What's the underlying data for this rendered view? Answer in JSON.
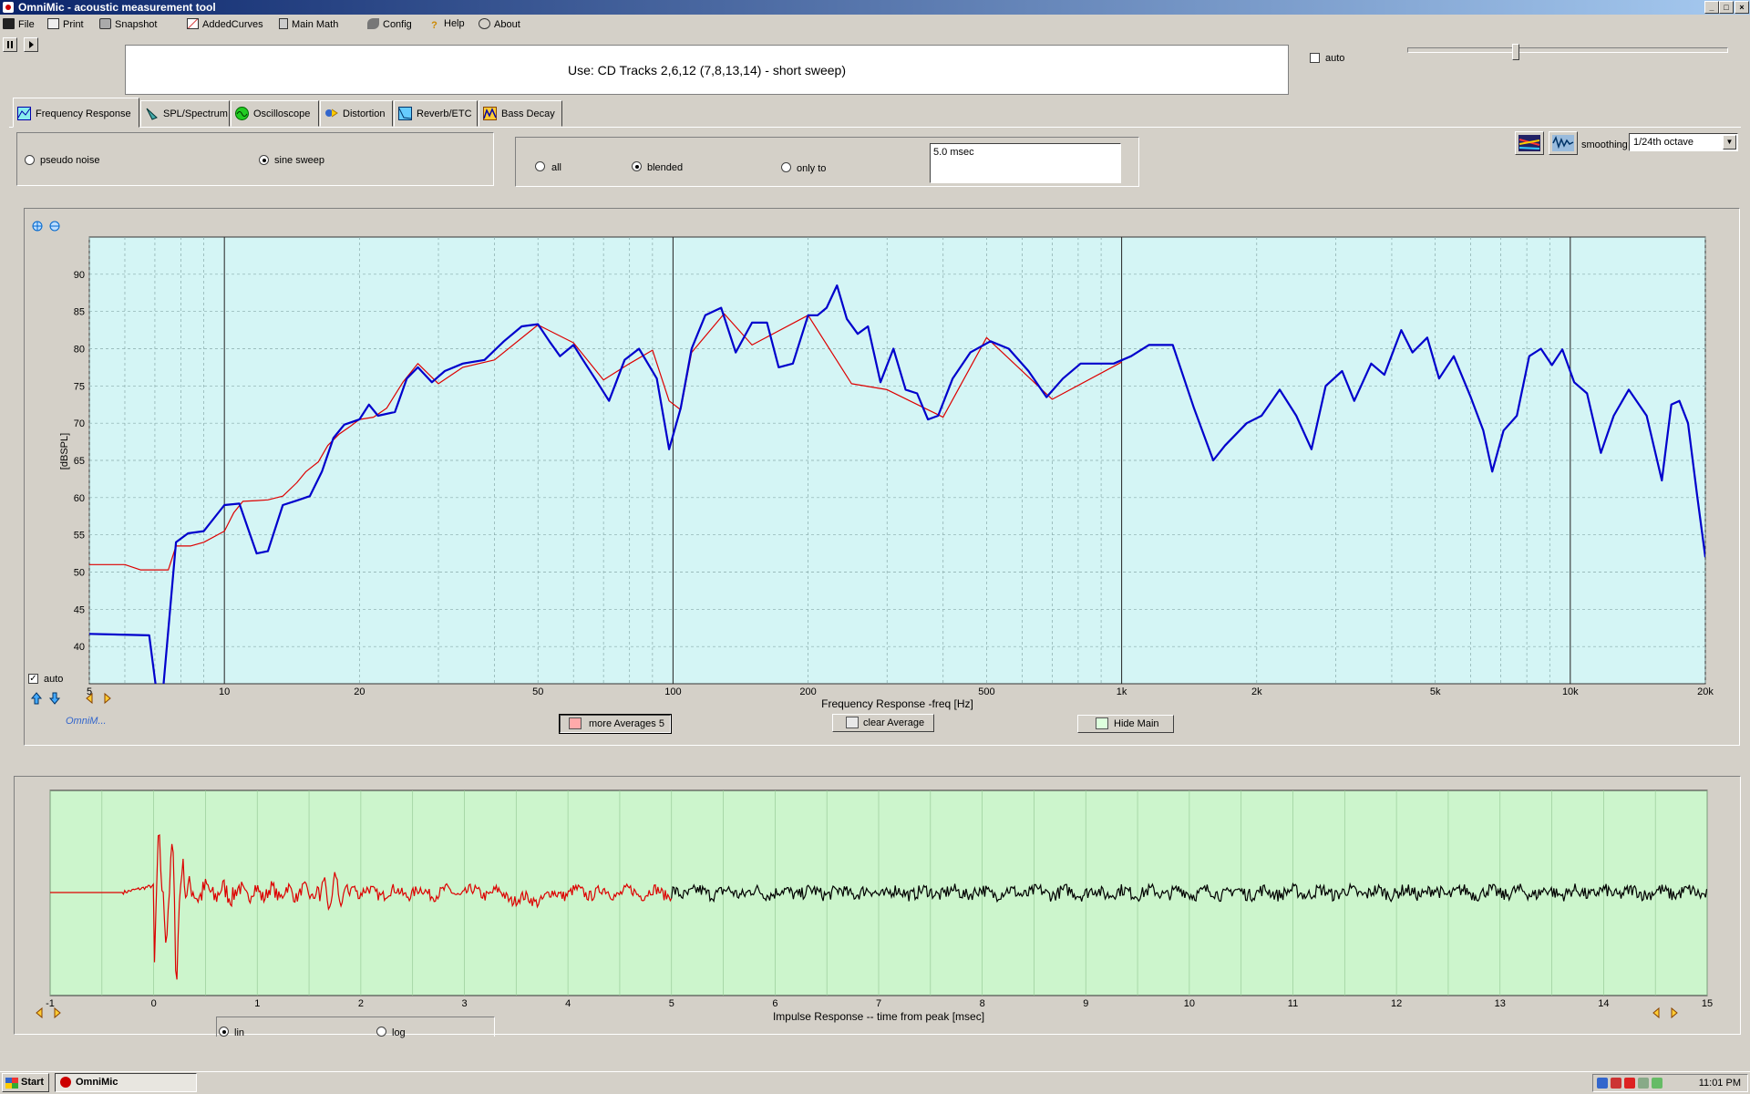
{
  "window": {
    "title": "OmniMic - acoustic measurement tool",
    "min": "_",
    "max": "□",
    "close": "×"
  },
  "menu": [
    {
      "label": "File"
    },
    {
      "label": "Print"
    },
    {
      "label": "Snapshot"
    },
    {
      "label": "AddedCurves"
    },
    {
      "label": "Main Math"
    },
    {
      "label": "Config"
    },
    {
      "label": "Help"
    },
    {
      "label": "About"
    }
  ],
  "instruction": "Use: CD Tracks 2,6,12 (7,8,13,14) - short sweep)",
  "top_auto_label": "auto",
  "tabs": [
    {
      "label": "Frequency Response",
      "active": true
    },
    {
      "label": "SPL/Spectrum"
    },
    {
      "label": "Oscilloscope"
    },
    {
      "label": "Distortion"
    },
    {
      "label": "Reverb/ETC"
    },
    {
      "label": "Bass Decay"
    }
  ],
  "signal": {
    "options": [
      {
        "label": "pseudo noise",
        "selected": false
      },
      {
        "label": "sine sweep",
        "selected": true
      }
    ]
  },
  "gating": {
    "options": [
      {
        "label": "all",
        "selected": false
      },
      {
        "label": "blended",
        "selected": true
      },
      {
        "label": "only to",
        "selected": false
      }
    ],
    "window_value": "5.0 msec"
  },
  "smoothing": {
    "label": "smoothing",
    "value": "1/24th octave"
  },
  "freq_panel": {
    "auto_label": "auto",
    "auto_checked": true,
    "logo_text": "OmniM...",
    "buttons": {
      "more_averages": "more Averages 5",
      "clear_average": "clear Average",
      "hide_main": "Hide Main"
    }
  },
  "impulse_panel": {
    "scale_options": [
      {
        "label": "lin",
        "selected": true
      },
      {
        "label": "log",
        "selected": false
      }
    ]
  },
  "chart_data": [
    {
      "type": "line",
      "title": "",
      "xlabel": "Frequency Response -freq [Hz]",
      "ylabel": "[dBSPL]",
      "x_scale": "log",
      "xlim": [
        5,
        20000
      ],
      "ylim": [
        35,
        95
      ],
      "x_ticks": [
        5,
        10,
        20,
        50,
        100,
        200,
        500,
        1000,
        2000,
        5000,
        10000,
        20000
      ],
      "x_tick_labels": [
        "5",
        "10",
        "20",
        "50",
        "100",
        "200",
        "500",
        "1k",
        "2k",
        "5k",
        "10k",
        "20k"
      ],
      "y_ticks": [
        40,
        45,
        50,
        55,
        60,
        65,
        70,
        75,
        80,
        85,
        90
      ],
      "grid": true,
      "series": [
        {
          "color": "#0000cc",
          "x": [
            5,
            6.8,
            7.2,
            7.8,
            8.3,
            9,
            10,
            10.8,
            11.8,
            12.5,
            13.5,
            14.5,
            15.5,
            16.5,
            17.5,
            18.5,
            20,
            21,
            22,
            24,
            25.5,
            27,
            29,
            31,
            34,
            38,
            42,
            46,
            50,
            53,
            56,
            60,
            63,
            67,
            72,
            78,
            84,
            92,
            98,
            104,
            110,
            118,
            128,
            138,
            150,
            162,
            172,
            185,
            200,
            210,
            220,
            232,
            244,
            258,
            272,
            290,
            310,
            330,
            350,
            370,
            390,
            420,
            460,
            510,
            560,
            620,
            680,
            740,
            810,
            880,
            960,
            1050,
            1150,
            1300,
            1450,
            1600,
            1700,
            1900,
            2050,
            2250,
            2450,
            2650,
            2850,
            3100,
            3300,
            3600,
            3850,
            4200,
            4450,
            4800,
            5100,
            5500,
            6000,
            6400,
            6700,
            7100,
            7600,
            8100,
            8600,
            9100,
            9600,
            10200,
            10900,
            11700,
            12500,
            13500,
            14800,
            16000,
            16800,
            17500,
            18300,
            19200,
            20000
          ],
          "y": [
            41.7,
            41.5,
            30,
            54,
            55.2,
            55.5,
            59,
            59.2,
            52.5,
            52.8,
            59,
            59.6,
            60.2,
            63.5,
            68,
            69.8,
            70.5,
            72.5,
            71,
            71.5,
            76,
            77.5,
            75.5,
            77,
            78,
            78.5,
            81,
            83,
            83.3,
            81,
            79,
            80.5,
            78.5,
            76,
            73,
            78.5,
            80,
            76,
            66.5,
            72,
            80,
            84.5,
            85.5,
            79.5,
            83.5,
            83.5,
            77.5,
            78,
            84.5,
            84.5,
            85.5,
            88.5,
            84,
            82,
            83,
            75.5,
            80,
            74.5,
            74,
            70.5,
            71,
            76,
            79.5,
            81,
            80,
            77,
            73.5,
            76,
            78,
            78,
            78,
            79,
            80.5,
            80.5,
            72,
            65,
            67,
            70,
            71,
            74.5,
            71,
            66.5,
            75,
            77,
            73,
            78,
            76.5,
            82.5,
            79.5,
            81.5,
            76,
            79,
            73.5,
            69,
            63.5,
            69,
            71,
            79,
            80,
            77.8,
            79.9,
            75.5,
            74,
            66,
            71,
            74.5,
            71,
            62.3,
            72.5,
            73,
            70,
            60,
            52
          ]
        },
        {
          "color": "#dd0000",
          "x": [
            5,
            5.5,
            6,
            6.5,
            7.2,
            7.5,
            7.8,
            8.4,
            9,
            10,
            10.5,
            11,
            11.8,
            12.5,
            13.5,
            14.5,
            15.2,
            16.2,
            17,
            18,
            19,
            20,
            21.5,
            23,
            25,
            27,
            30,
            34,
            40,
            50,
            60,
            70,
            80,
            90,
            98,
            104,
            110,
            130,
            150,
            200,
            250,
            300,
            400,
            500,
            700,
            1000
          ],
          "y": [
            51,
            51,
            51,
            50.3,
            50.3,
            50.3,
            53.5,
            53.5,
            54,
            55.5,
            58,
            59.5,
            59.6,
            59.7,
            60.2,
            62,
            63.5,
            64.8,
            67,
            68.5,
            69.5,
            70.5,
            70.8,
            72,
            75.5,
            78,
            75.3,
            77.5,
            78.5,
            83.2,
            80.8,
            75.8,
            78,
            79.8,
            73,
            71.8,
            79.5,
            84.7,
            80.5,
            84.5,
            75.3,
            74.5,
            70.8,
            81.5,
            73.2,
            78.2
          ]
        }
      ]
    },
    {
      "type": "line",
      "title": "",
      "xlabel": "Impulse Response  -- time from peak [msec]",
      "ylabel": "",
      "xlim": [
        -1,
        15
      ],
      "x_ticks": [
        -1,
        0,
        1,
        2,
        3,
        4,
        5,
        6,
        7,
        8,
        9,
        10,
        11,
        12,
        13,
        14,
        15
      ],
      "grid": true,
      "series": [
        {
          "color": "#dd0000",
          "range_ms": [
            -1,
            5
          ],
          "peak_ms": 0,
          "note_shape": "large spikes near 0 ms, decaying ringing to 5 ms"
        },
        {
          "color": "#000000",
          "range_ms": [
            5,
            15
          ]
        }
      ]
    }
  ],
  "taskbar": {
    "start_label": "Start",
    "task_label": "OmniMic",
    "clock": "11:01 PM"
  }
}
